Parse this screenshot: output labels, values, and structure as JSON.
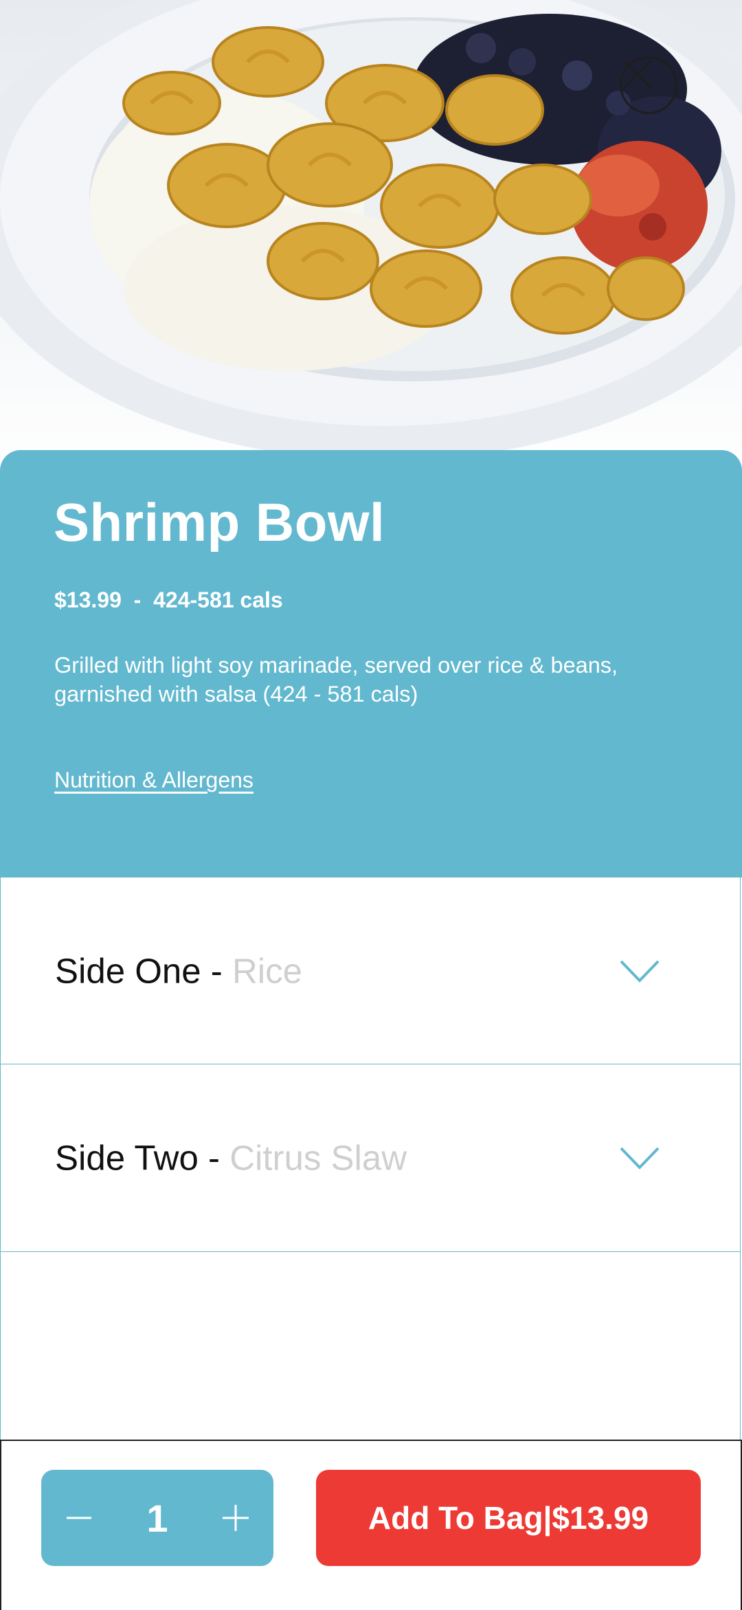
{
  "colors": {
    "accent": "#62b8cf",
    "cta": "#ee3a35",
    "text_dark": "#111111",
    "placeholder": "#cfcfcf"
  },
  "hero": {
    "image": "shrimp bowl with rice, black beans and salsa"
  },
  "close": {
    "icon": "close-icon"
  },
  "item": {
    "title": "Shrimp Bowl",
    "price": "$13.99",
    "separator": "-",
    "calories": "424-581 cals",
    "description": "Grilled with light soy marinade, served over rice & beans, garnished with salsa (424 - 581 cals)",
    "nutrition_link": "Nutrition & Allergens"
  },
  "options": [
    {
      "label": "Side One - ",
      "value": "Rice",
      "icon": "chevron-down-icon"
    },
    {
      "label": "Side Two - ",
      "value": "Citrus Slaw",
      "icon": "chevron-down-icon"
    }
  ],
  "footer": {
    "quantity": "1",
    "minus_icon": "minus-icon",
    "plus_icon": "plus-icon",
    "add_label": "Add To Bag",
    "add_divider": "|",
    "add_price": "$13.99"
  }
}
